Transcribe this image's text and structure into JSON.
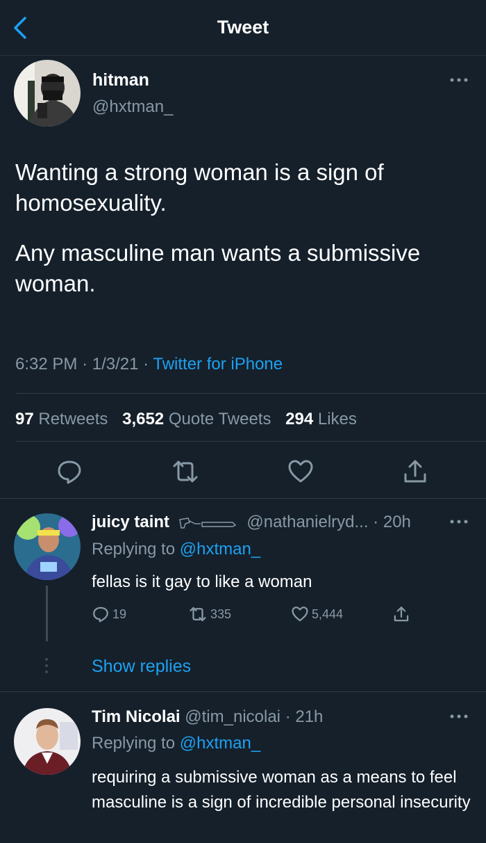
{
  "header": {
    "title": "Tweet"
  },
  "main_tweet": {
    "display_name": "hitman",
    "handle": "@hxtman_",
    "paragraphs": [
      "Wanting a strong woman is a sign of homosexuality.",
      "Any masculine man wants a submissive woman."
    ],
    "time": "6:32 PM",
    "date": "1/3/21",
    "source": "Twitter for iPhone",
    "retweets_count": "97",
    "retweets_label": "Retweets",
    "quotes_count": "3,652",
    "quotes_label": "Quote Tweets",
    "likes_count": "294",
    "likes_label": "Likes"
  },
  "replies": [
    {
      "display_name": "juicy taint",
      "handle": "@nathanielryd...",
      "age": "20h",
      "replying_prefix": "Replying to",
      "replying_to": "@hxtman_",
      "text": "fellas is it gay to like a woman",
      "reply_count": "19",
      "retweet_count": "335",
      "like_count": "5,444",
      "show_replies": "Show replies"
    },
    {
      "display_name": "Tim Nicolai",
      "handle": "@tim_nicolai",
      "age": "21h",
      "replying_prefix": "Replying to",
      "replying_to": "@hxtman_",
      "text": "requiring a submissive woman as a means to feel masculine is a sign of incredible personal insecurity"
    }
  ],
  "colors": {
    "background": "#15202b",
    "accent": "#1da1f2",
    "secondary_text": "#8899a6"
  }
}
